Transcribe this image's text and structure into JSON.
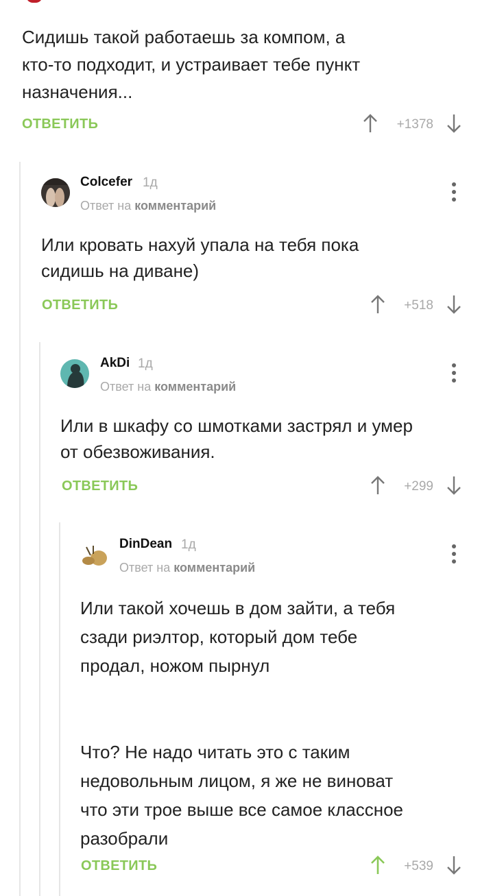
{
  "top_comment": {
    "text": "Сидишь такой работаешь за компом, а\nкто-то подходит, и устраивает тебе пункт\nназначения...",
    "reply_label": "ОТВЕТИТЬ",
    "rating": "+1378"
  },
  "comments": [
    {
      "author": "Colcefer",
      "time": "1д",
      "reply_prefix": "Ответ на",
      "reply_target": "комментарий",
      "text": "Или кровать нахуй упала на тебя пока\nсидишь на диване)",
      "reply_label": "ОТВЕТИТЬ",
      "rating": "+518"
    },
    {
      "author": "AkDi",
      "time": "1д",
      "reply_prefix": "Ответ на",
      "reply_target": "комментарий",
      "text": "Или в шкафу со шмотками застрял и умер\nот обезвоживания.",
      "reply_label": "ОТВЕТИТЬ",
      "rating": "+299"
    },
    {
      "author": "DinDean",
      "time": "1д",
      "reply_prefix": "Ответ на",
      "reply_target": "комментарий",
      "text": "Или такой хочешь в дом зайти, а тебя\nсзади риэлтор, который дом тебе\nпродал, ножом пырнул\n\n\nЧто? Не надо читать это с таким\nнедовольным лицом, я же не виноват\nчто эти трое выше все самое классное\nразобрали",
      "reply_label": "ОТВЕТИТЬ",
      "rating": "+539"
    }
  ],
  "colors": {
    "accent_green": "#8ac858",
    "muted": "#a9a9a9"
  },
  "icons": {
    "vote_up": "arrow-up-icon",
    "vote_down": "arrow-down-icon",
    "menu": "kebab-menu-icon"
  }
}
